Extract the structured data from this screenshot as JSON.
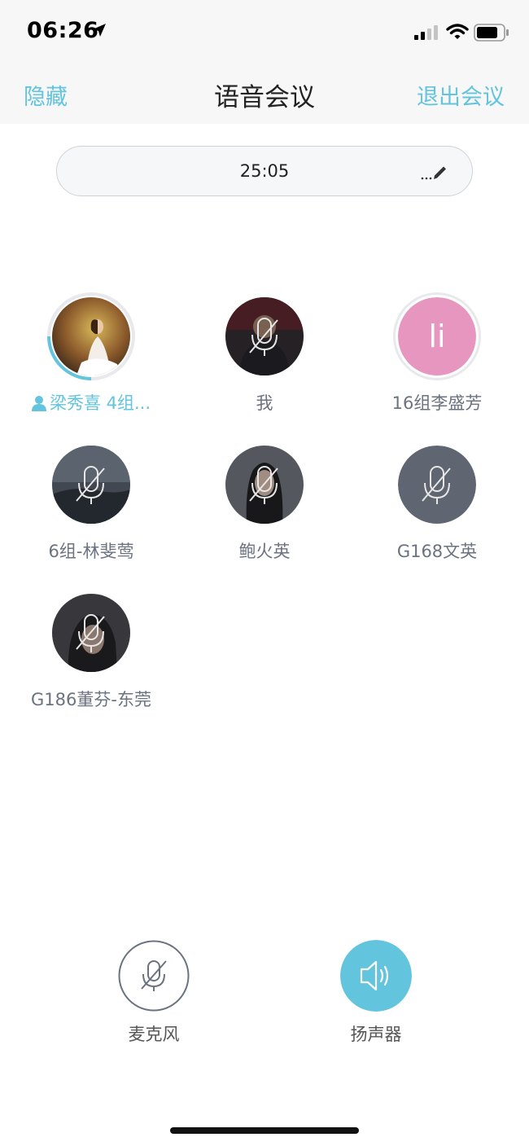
{
  "status": {
    "time": "06:26"
  },
  "nav": {
    "left": "隐藏",
    "title": "语音会议",
    "right": "退出会议"
  },
  "timer": {
    "value": "25:05"
  },
  "participants": [
    {
      "name": "梁秀喜 4组...",
      "speaking": true,
      "muted": false
    },
    {
      "name": "我",
      "muted": true
    },
    {
      "name": "16组李盛芳",
      "initials": "li",
      "muted": false
    },
    {
      "name": "6组-林斐莺",
      "muted": true
    },
    {
      "name": "鲍火英",
      "muted": true
    },
    {
      "name": "G168文英",
      "muted": true
    },
    {
      "name": "G186董芬-东莞",
      "muted": true
    }
  ],
  "controls": {
    "mic_label": "麦克风",
    "speaker_label": "扬声器"
  },
  "colors": {
    "accent": "#63c4de",
    "pink_avatar": "#e796bf",
    "grey_avatar": "#5f6671"
  }
}
